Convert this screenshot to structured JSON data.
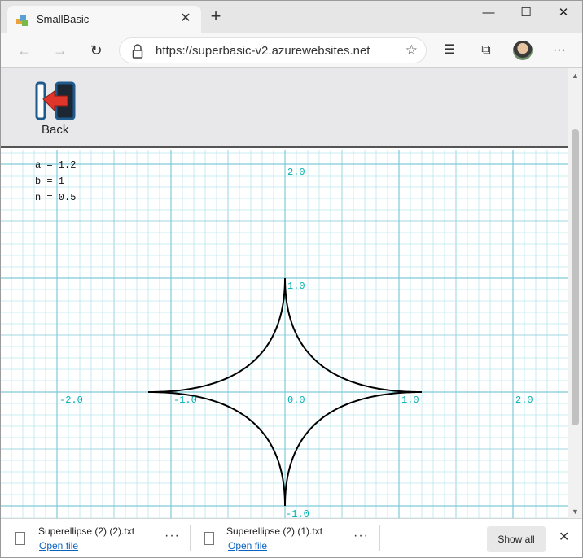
{
  "browser": {
    "tab_title": "SmallBasic",
    "url": "https://superbasic-v2.azurewebsites.net",
    "tab_close": "✕",
    "new_tab": "+",
    "window_buttons": {
      "minimize": "—",
      "maximize": "☐",
      "close": "✕"
    },
    "toolbar_more": "···"
  },
  "app": {
    "back_label": "Back",
    "params": [
      "a = 1.2",
      "b = 1",
      "n = 0.5"
    ]
  },
  "axes": {
    "x_labels": [
      "-2.0",
      "-1.0",
      "0.0",
      "1.0",
      "2.0"
    ],
    "y_labels": [
      "2.0",
      "1.0",
      "-1.0"
    ],
    "colors": {
      "major": "#7fcad8",
      "minor": "#b9e6ea",
      "label": "#00b0b0",
      "curve": "#000000"
    }
  },
  "downloads": {
    "items": [
      {
        "name": "Superellipse (2) (2).txt",
        "action": "Open file"
      },
      {
        "name": "Superellipse (2) (1).txt",
        "action": "Open file"
      }
    ],
    "more": "···",
    "show_all": "Show all",
    "close": "✕"
  }
}
